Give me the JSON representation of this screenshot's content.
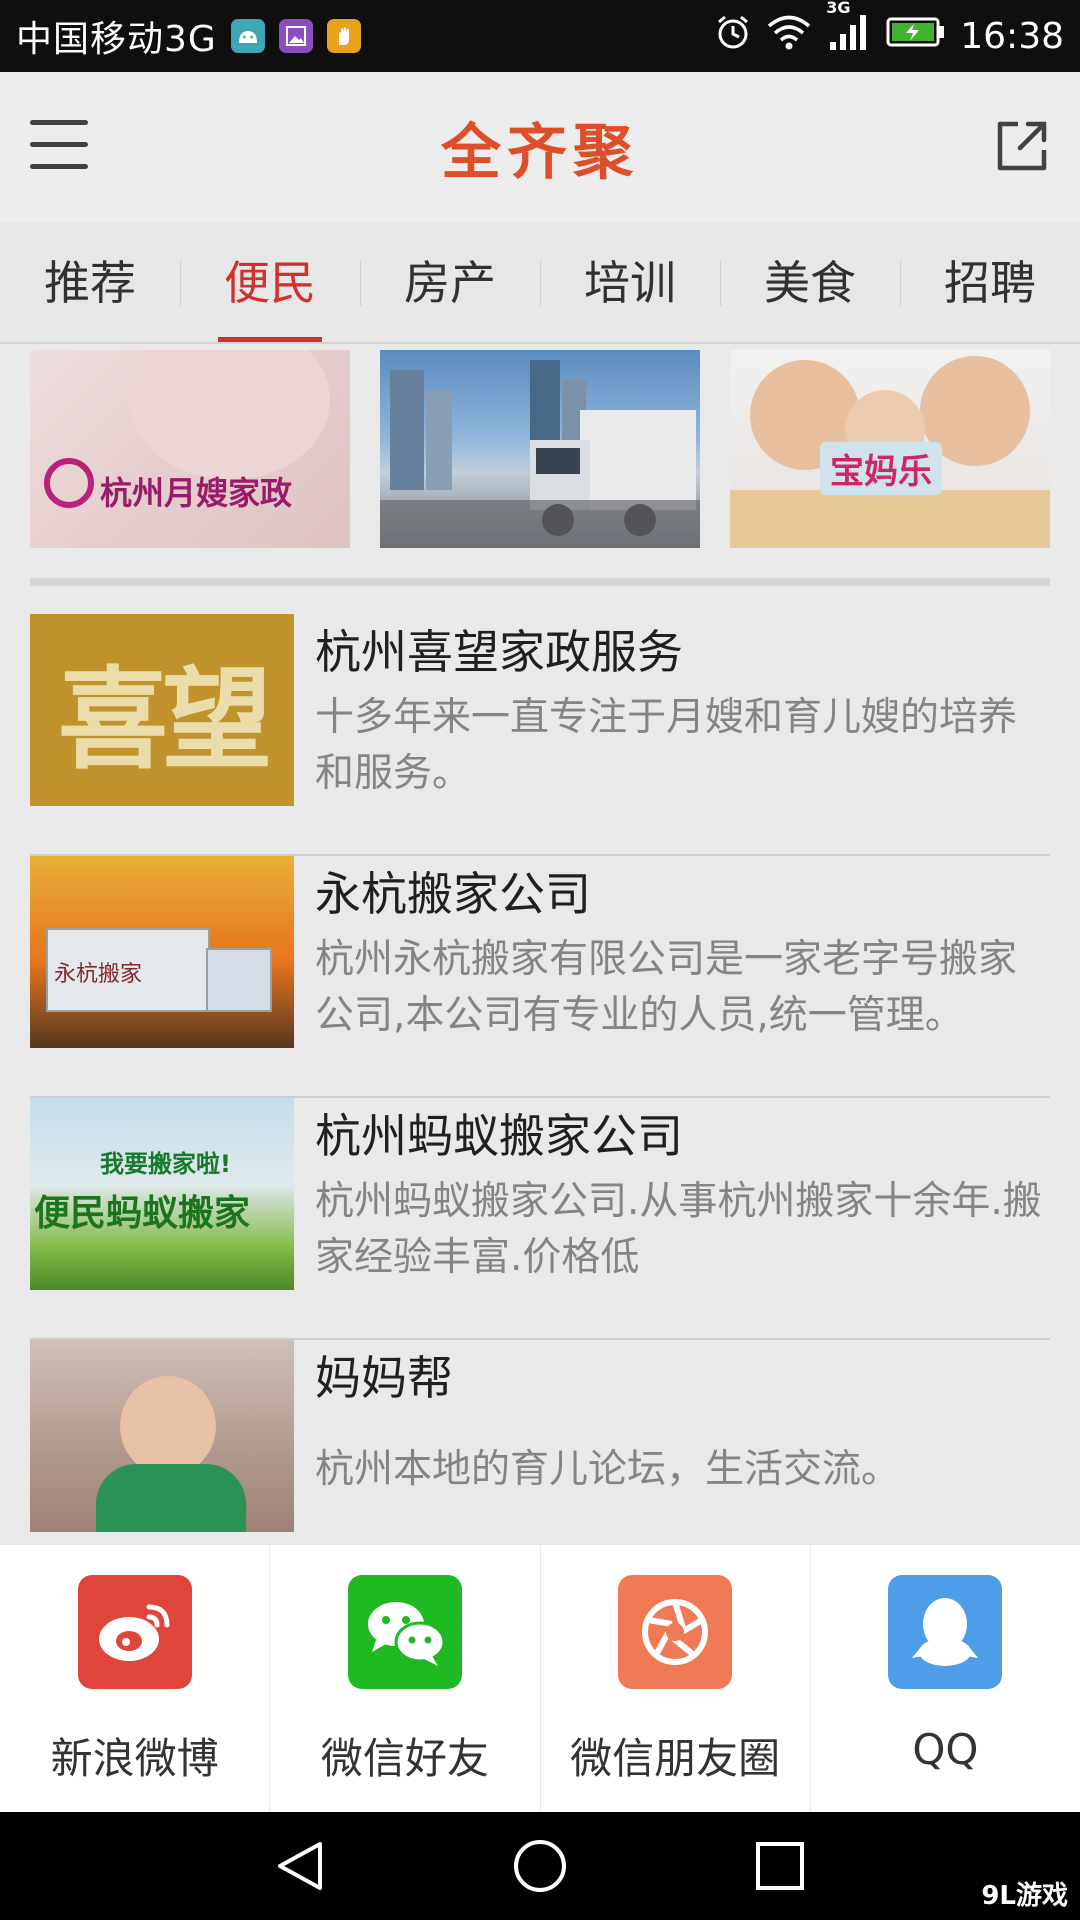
{
  "status_bar": {
    "carrier": "中国移动3G",
    "network_badge": "3G",
    "time": "16:38",
    "icons": [
      "android-icon",
      "gallery-icon",
      "hand-icon",
      "alarm-icon",
      "wifi-icon",
      "signal-icon",
      "battery-icon"
    ]
  },
  "header": {
    "title": "全齐聚",
    "menu_icon": "hamburger-menu-icon",
    "share_icon": "share-external-icon",
    "title_color": "#e8522b"
  },
  "tabs": [
    {
      "label": "推荐",
      "active": false
    },
    {
      "label": "便民",
      "active": true
    },
    {
      "label": "房产",
      "active": false
    },
    {
      "label": "培训",
      "active": false
    },
    {
      "label": "美食",
      "active": false
    },
    {
      "label": "招聘",
      "active": false
    }
  ],
  "banners": [
    {
      "label": "杭州月嫂家政"
    },
    {
      "label": ""
    },
    {
      "label": "宝妈乐"
    }
  ],
  "listings": [
    {
      "title": "杭州喜望家政服务",
      "description": "十多年来一直专注于月嫂和育儿嫂的培养和服务。",
      "thumb_text": "喜望"
    },
    {
      "title": "永杭搬家公司",
      "description": " 杭州永杭搬家有限公司是一家老字号搬家公司,本公司有专业的人员,统一管理。",
      "thumb_text": "永杭搬家"
    },
    {
      "title": "杭州蚂蚁搬家公司",
      "description": "杭州蚂蚁搬家公司.从事杭州搬家十余年.搬家经验丰富.价格低",
      "thumb_text": "便民蚂蚁搬家",
      "thumb_subtext": "我要搬家啦!"
    },
    {
      "title": "妈妈帮",
      "description": "杭州本地的育儿论坛，生活交流。"
    }
  ],
  "share_sheet": {
    "items": [
      {
        "label": "新浪微博",
        "icon": "weibo-icon",
        "color": "#e0453c"
      },
      {
        "label": "微信好友",
        "icon": "wechat-icon",
        "color": "#1fb922"
      },
      {
        "label": "微信朋友圈",
        "icon": "wechat-moments-icon",
        "color": "#f07a55"
      },
      {
        "label": "QQ",
        "icon": "qq-icon",
        "color": "#4d9de8"
      }
    ]
  },
  "nav_bar": {
    "buttons": [
      "back-icon",
      "home-icon",
      "recents-icon"
    ],
    "watermark": "9L游戏"
  }
}
